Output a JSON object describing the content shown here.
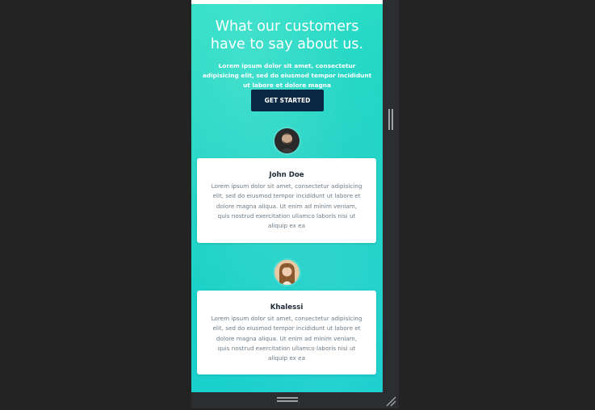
{
  "hero": {
    "title": "What our customers have to say about us.",
    "subtitle": "Lorem ipsum dolor sit amet, consectetur adipisicing elit, sed do eiusmod tempor incididunt ut labore et dolore magna",
    "cta_label": "GET STARTED"
  },
  "testimonials": [
    {
      "name": "John Doe",
      "avatar_icon": "man-avatar-icon",
      "text": "Lorem ipsum dolor sit amet, consectetur adipisicing elit, sed do eiusmod tempor incididunt ut labore et dolore magna aliqua. Ut enim ad minim veniam, quis nostrud exercitation ullamco laboris nisi ut aliquip ex ea"
    },
    {
      "name": "Khalessi",
      "avatar_icon": "woman-avatar-icon",
      "text": "Lorem ipsum dolor sit amet, consectetur adipisicing elit, sed do eiusmod tempor incididunt ut labore et dolore magna aliqua. Ut enim ad minim veniam, quis nostrud exercitation ullamco laboris nisi ut aliquip ex ea"
    }
  ],
  "editor": {
    "vertical_handle_icon": "vertical-drag-handle-icon",
    "horizontal_handle_icon": "horizontal-drag-handle-icon",
    "corner_handle_icon": "resize-corner-icon"
  },
  "colors": {
    "accent": "#1ed3c4",
    "button": "#0c2742",
    "background": "#232323"
  }
}
